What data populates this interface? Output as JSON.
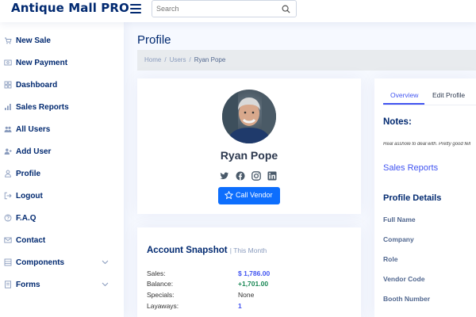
{
  "header": {
    "logo": "Antique Mall PRO",
    "search_placeholder": "Search"
  },
  "sidebar": {
    "items": [
      {
        "label": "New Sale",
        "icon": "cart-plus-icon"
      },
      {
        "label": "New Payment",
        "icon": "cash-icon"
      },
      {
        "label": "Dashboard",
        "icon": "grid-icon"
      },
      {
        "label": "Sales Reports",
        "icon": "bar-chart-icon"
      },
      {
        "label": "All Users",
        "icon": "people-icon"
      },
      {
        "label": "Add User",
        "icon": "person-plus-icon"
      },
      {
        "label": "Profile",
        "icon": "person-icon"
      },
      {
        "label": "Logout",
        "icon": "box-arrow-icon"
      },
      {
        "label": "F.A.Q",
        "icon": "question-circle-icon"
      },
      {
        "label": "Contact",
        "icon": "envelope-icon"
      },
      {
        "label": "Components",
        "icon": "menu-icon",
        "expandable": true
      },
      {
        "label": "Forms",
        "icon": "form-icon",
        "expandable": true
      }
    ]
  },
  "page": {
    "title": "Profile",
    "breadcrumb": [
      "Home",
      "Users",
      "Ryan Pope"
    ]
  },
  "profile": {
    "name": "Ryan Pope",
    "socials": [
      "twitter-icon",
      "facebook-icon",
      "instagram-icon",
      "linkedin-icon"
    ],
    "call_button": "Call Vendor"
  },
  "snapshot": {
    "title": "Account Snapshot",
    "subtitle": "| This Month",
    "rows": [
      {
        "label": "Sales:",
        "value": "$ 1,786.00"
      },
      {
        "label": "Balance:",
        "value": "+1,701.00"
      },
      {
        "label": "Specials:",
        "value": "None"
      },
      {
        "label": "Layaways:",
        "value": "1"
      }
    ]
  },
  "details_panel": {
    "tabs": [
      "Overview",
      "Edit Profile"
    ],
    "active_tab": "Overview",
    "notes_title": "Notes:",
    "notes_text": "Real asshole to deal with. Pretty good fell",
    "sales_reports_link": "Sales Reports",
    "profile_details_title": "Profile Details",
    "fields": [
      "Full Name",
      "Company",
      "Role",
      "Vendor Code",
      "Booth Number"
    ]
  },
  "colors": {
    "brand": "#012970",
    "accent": "#4154f1",
    "button": "#0d6efd",
    "positive": "#198754"
  }
}
